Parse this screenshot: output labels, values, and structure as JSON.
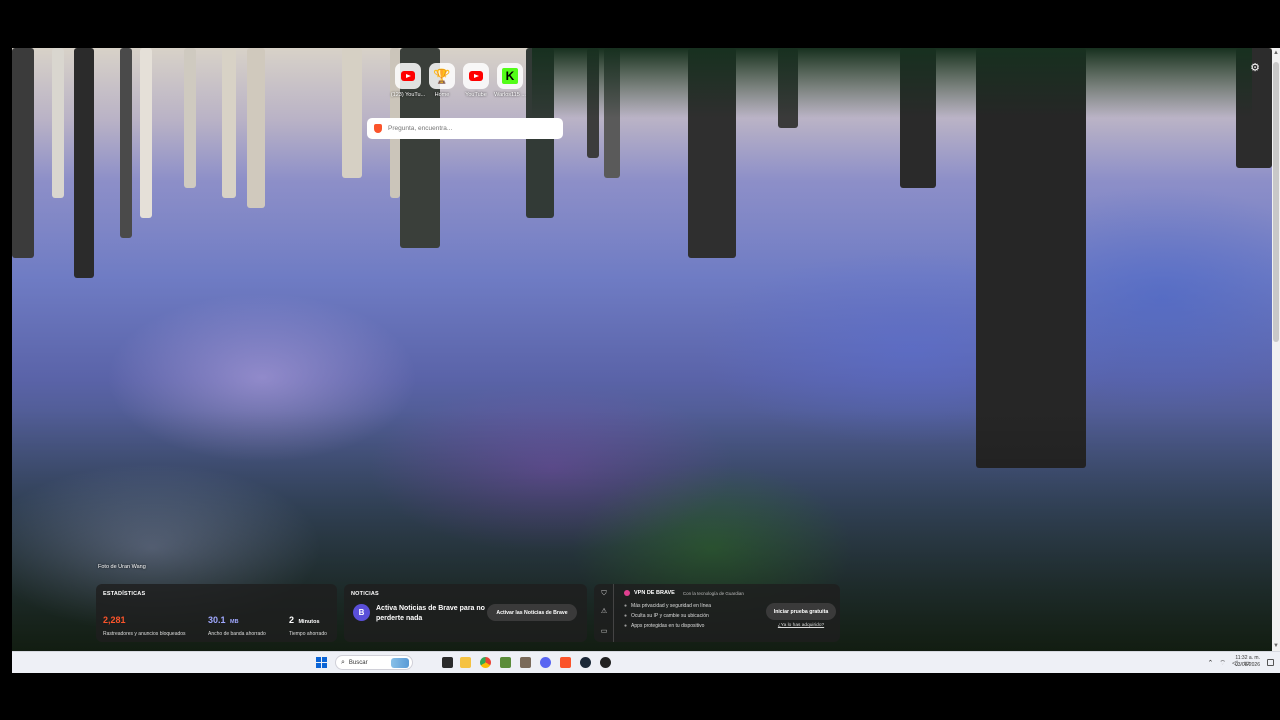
{
  "top_sites": [
    {
      "label": "(123) YouTu...",
      "icon": "youtube-icon"
    },
    {
      "label": "Home",
      "icon": "trophy-icon"
    },
    {
      "label": "YouTube",
      "icon": "youtube-icon"
    },
    {
      "label": "Warlos115 ...",
      "icon": "kick-icon"
    }
  ],
  "search": {
    "placeholder": "Pregunta, encuentra..."
  },
  "photo_credit": "Foto de Uran Wang",
  "stats": {
    "title": "ESTADÍSTICAS",
    "trackers_value": "2,281",
    "trackers_label": "Rastreadores y anuncios bloqueados",
    "bandwidth_value": "30.1",
    "bandwidth_unit": "MB",
    "bandwidth_label": "Ancho de banda ahorrado",
    "time_value": "2",
    "time_unit": "Minutos",
    "time_label": "Tiempo ahorrado"
  },
  "news": {
    "title": "NOTICIAS",
    "text": "Activa Noticias de Brave para no perderte nada",
    "button": "Activar las Noticias de Brave"
  },
  "vpn": {
    "title": "VPN DE BRAVE",
    "subtitle": "Con la tecnología de Guardian",
    "features": [
      "Más privacidad y seguridad en línea",
      "Oculta su IP y cambie su ubicación",
      "Apps protegidas en tu dispositivo"
    ],
    "trial_button": "Iniciar prueba gratuita",
    "purchased_link": "¿Ya lo has adquirido?"
  },
  "taskbar": {
    "search_label": "Buscar",
    "time": "11:32 a. m.",
    "date": "03/08/2026"
  },
  "colors": {
    "trackers": "#fb542b",
    "bandwidth": "#a0a8ff",
    "brave": "#fb542b",
    "news_logo": "#5a4fd8"
  }
}
